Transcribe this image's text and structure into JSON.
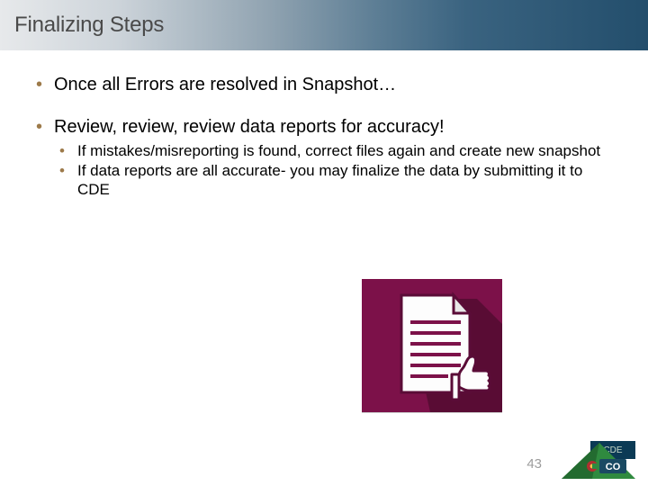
{
  "title": "Finalizing Steps",
  "bullets": {
    "b1": "Once all Errors are resolved in Snapshot…",
    "b2": "Review, review, review data reports for accuracy!",
    "b2_children": {
      "c1": "If mistakes/misreporting is found, correct files again and create new snapshot",
      "c2": "If data reports are all accurate- you may finalize the data by submitting it to CDE"
    }
  },
  "graphic": {
    "name": "document-thumbs-up-icon",
    "bg_color": "#7c1149"
  },
  "footer": {
    "page_number": "43",
    "logo_label_top": "CDE",
    "logo_label_state": "CO"
  }
}
